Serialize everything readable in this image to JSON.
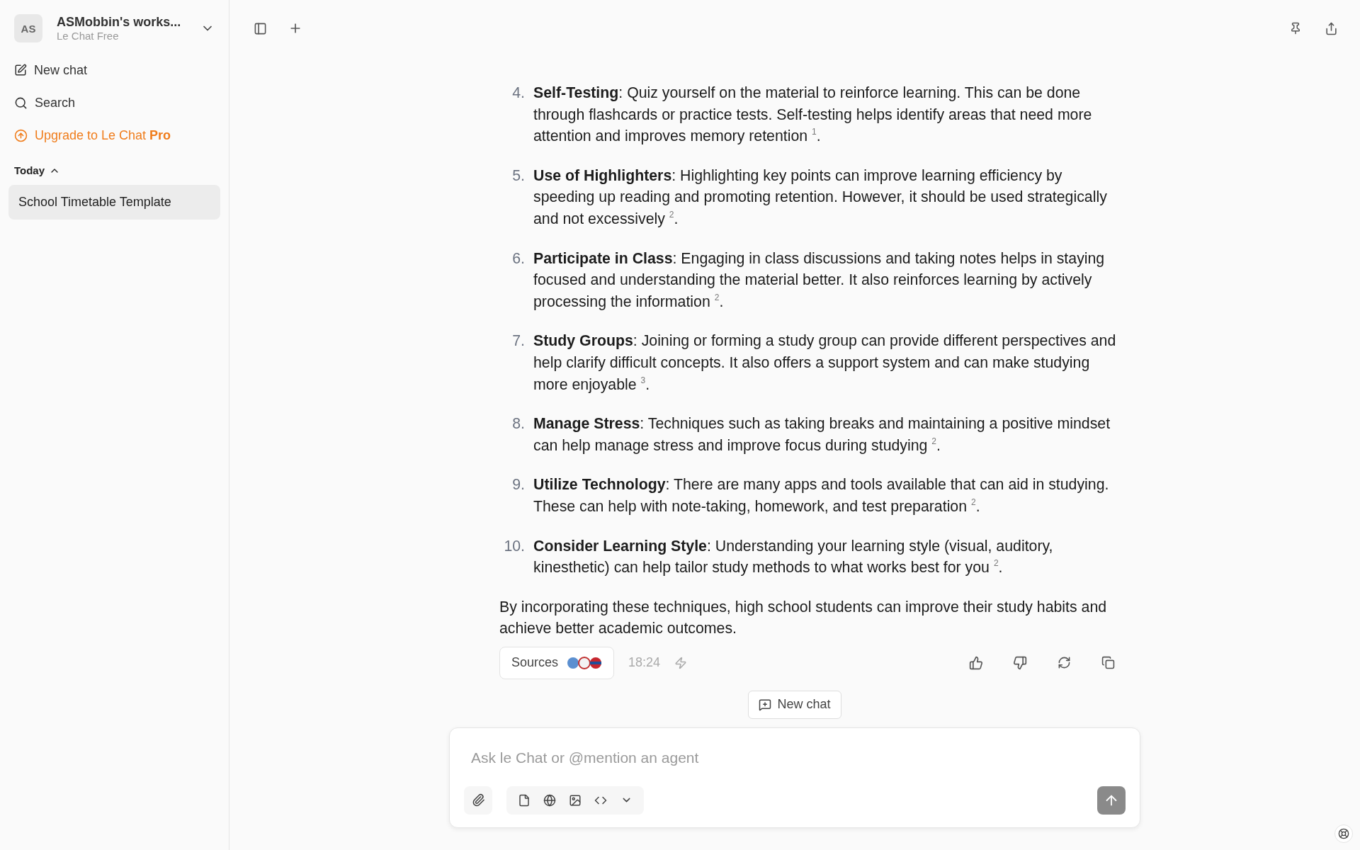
{
  "workspace": {
    "avatar": "AS",
    "name": "ASMobbin's works...",
    "plan": "Le Chat Free"
  },
  "sidebar": {
    "items": [
      {
        "kind": "new",
        "label": "New chat"
      },
      {
        "kind": "search",
        "label": "Search"
      },
      {
        "kind": "upgrade",
        "label": "Upgrade to Le Chat **Pro**"
      }
    ],
    "section": {
      "label": "Today",
      "expanded": true
    },
    "chats": [
      {
        "label": "School Timetable Template",
        "selected": true
      }
    ]
  },
  "answer": {
    "items": [
      {
        "number": "4.",
        "title": "Self-Testing",
        "text": ": Quiz yourself on the material to reinforce learning. This can be done through flashcards or practice tests. Self-testing helps identify areas that need more attention and improves memory retention $^{1}$."
      },
      {
        "number": "5.",
        "title": "Use of Highlighters",
        "text": ": Highlighting key points can improve learning efficiency by speeding up reading and promoting retention. However, it should be used strategically and not excessively $^{2}$."
      },
      {
        "number": "6.",
        "title": "Participate in Class",
        "text": ": Engaging in class discussions and taking notes helps in staying focused and understanding the material better. It also reinforces learning by actively processing the information $^{2}$."
      },
      {
        "number": "7.",
        "title": "Study Groups",
        "text": ": Joining or forming a study group can provide different perspectives and help clarify difficult concepts. It also offers a support system and can make studying more enjoyable $^{3}$."
      },
      {
        "number": "8.",
        "title": "Manage Stress",
        "text": ": Techniques such as taking breaks and maintaining a positive mindset can help manage stress and improve focus during studying $^{2}$."
      },
      {
        "number": "9.",
        "title": "Utilize Technology",
        "text": ": There are many apps and tools available that can aid in studying. These can help with note-taking, homework, and test preparation $^{2}$."
      },
      {
        "number": "10.",
        "title": "Consider Learning Style",
        "text": ": Understanding your learning style (visual, auditory, kinesthetic) can help tailor study methods to what works best for you $^{2}$."
      }
    ],
    "conclusion": "By incorporating these techniques, high school students can improve their study habits and achieve better academic outcomes.",
    "sources_label": "Sources",
    "time": "18:24"
  },
  "new_chat_button": "New chat",
  "composer": {
    "placeholder": "Ask le Chat or @mention an agent"
  }
}
